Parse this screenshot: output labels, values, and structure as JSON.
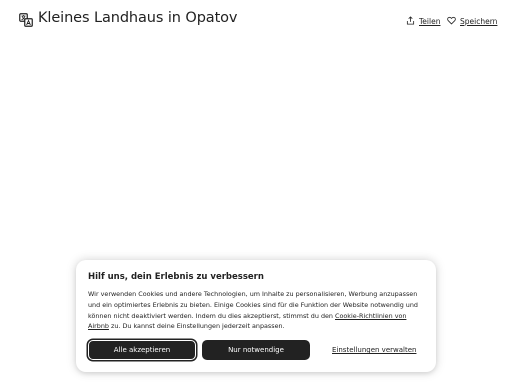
{
  "header": {
    "title": "Kleines Landhaus in Opatov",
    "translate_icon": "translate-icon",
    "actions": [
      {
        "label": "Teilen",
        "icon": "share-icon"
      },
      {
        "label": "Speichern",
        "icon": "heart-icon"
      }
    ]
  },
  "cookie_banner": {
    "heading": "Hilf uns, dein Erlebnis zu verbessern",
    "text_before_link": "Wir verwenden Cookies und andere Technologien, um Inhalte zu personalisieren, Werbung anzupassen und ein optimiertes Erlebnis zu bieten. Einige Cookies sind für die Funktion der Website notwendig und können nicht deaktiviert werden. Indem du dies akzeptierst, stimmst du den ",
    "link_text": "Cookie-Richtlinien von Airbnb",
    "text_after_link": " zu. Du kannst deine Einstellungen jederzeit anpassen.",
    "accept_label": "Alle akzeptieren",
    "necessary_label": "Nur notwendige",
    "settings_label": "Einstellungen verwalten"
  },
  "colors": {
    "text": "#222222",
    "button_bg": "#222222",
    "button_text": "#ffffff",
    "background": "#ffffff"
  }
}
